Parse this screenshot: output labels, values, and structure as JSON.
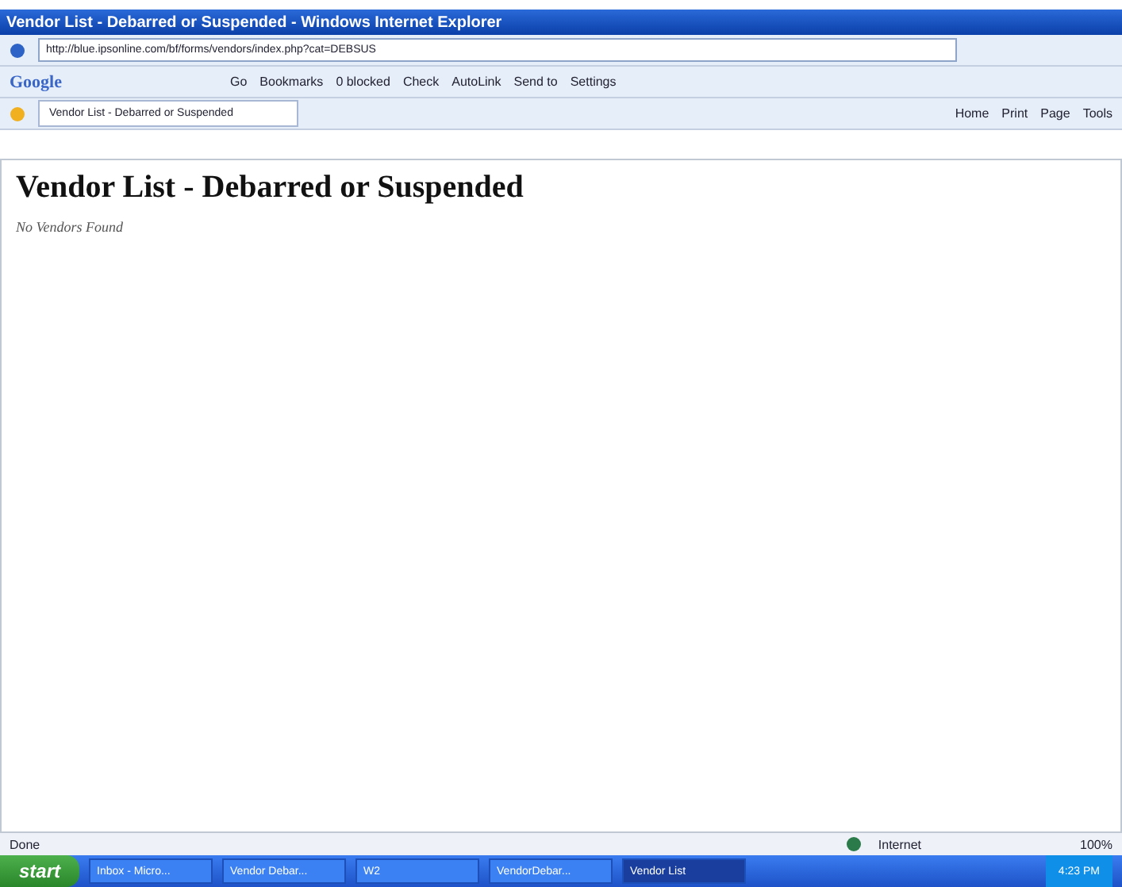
{
  "window": {
    "title": "Vendor List - Debarred or Suspended - Windows Internet Explorer"
  },
  "address_bar": {
    "url": "http://blue.ipsonline.com/bf/forms/vendors/index.php?cat=DEBSUS"
  },
  "google_toolbar": {
    "logo": "Google",
    "items": [
      {
        "label": "Go"
      },
      {
        "label": "Bookmarks"
      },
      {
        "label": "0 blocked"
      },
      {
        "label": "Check"
      },
      {
        "label": "AutoLink"
      },
      {
        "label": "Send to"
      },
      {
        "label": "Settings"
      }
    ]
  },
  "tabs": [
    {
      "label": "Vendor List - Debarred or Suspended",
      "selected": true
    }
  ],
  "command_bar": [
    {
      "label": "Home"
    },
    {
      "label": "Print"
    },
    {
      "label": "Page"
    },
    {
      "label": "Tools"
    }
  ],
  "page": {
    "heading": "Vendor List - Debarred or Suspended",
    "message": "No Vendors Found"
  },
  "status_bar": {
    "status": "Done",
    "zone": "Internet",
    "zoom": "100%"
  },
  "taskbar": {
    "start": "start",
    "tasks": [
      {
        "label": "Inbox - Micro...",
        "selected": false
      },
      {
        "label": "Vendor Debar...",
        "selected": false
      },
      {
        "label": "W2",
        "selected": false
      },
      {
        "label": "VendorDebar...",
        "selected": false
      },
      {
        "label": "Vendor List",
        "selected": true
      }
    ],
    "clock": "4:23 PM"
  }
}
